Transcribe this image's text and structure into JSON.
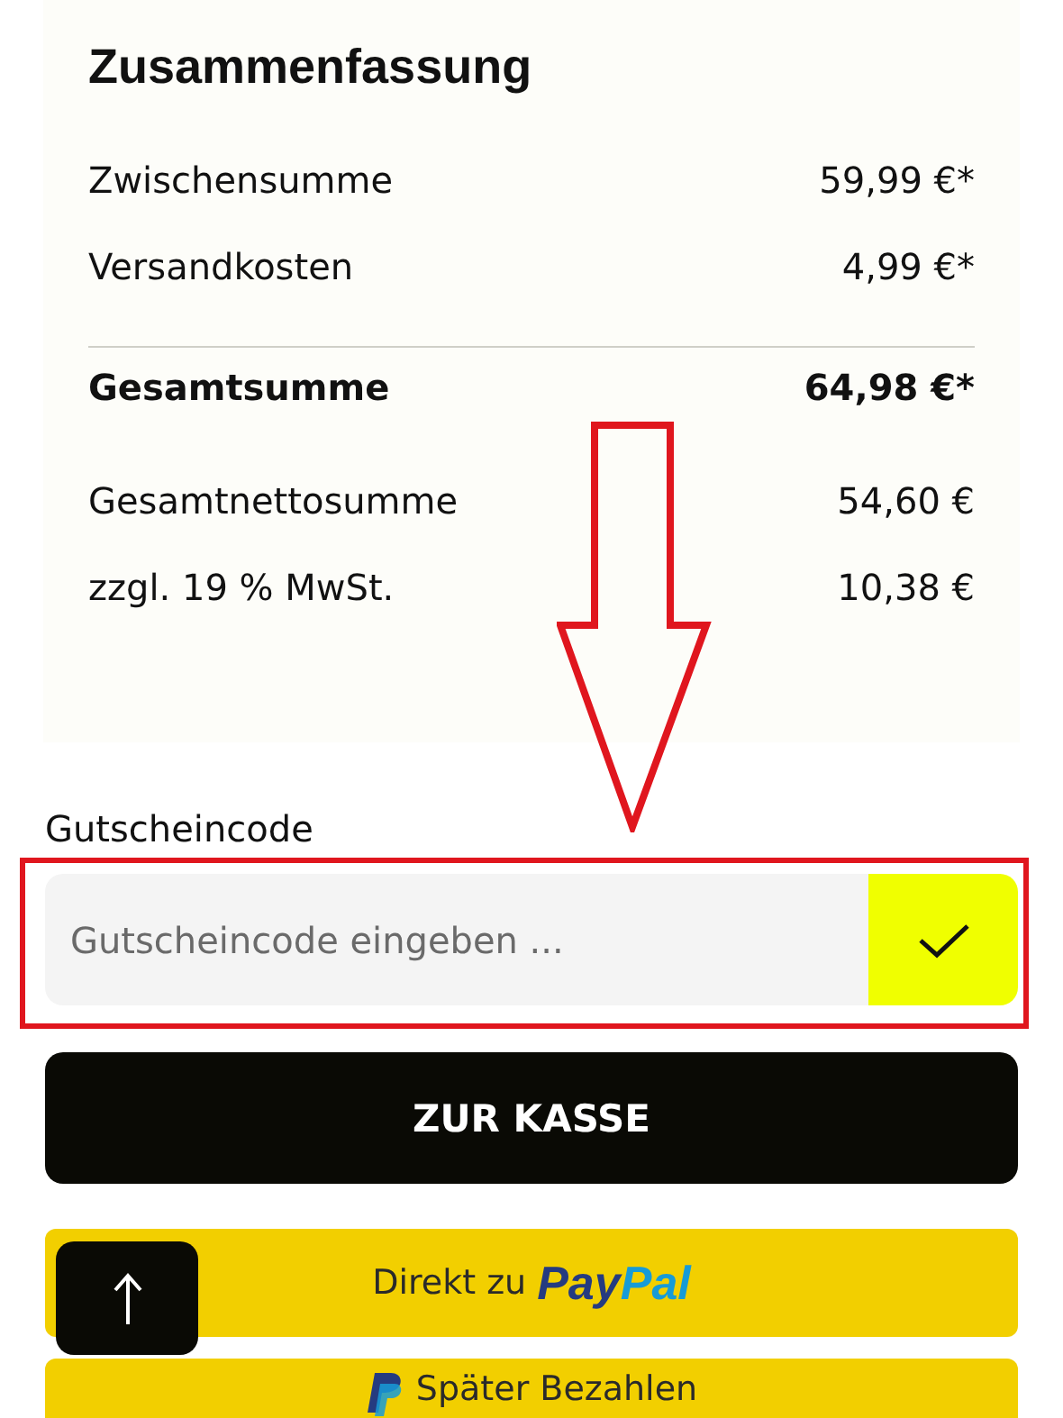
{
  "summary": {
    "title": "Zusammenfassung",
    "rows": [
      {
        "label": "Zwischensumme",
        "value": "59,99 €*",
        "kind": "normal"
      },
      {
        "label": "Versandkosten",
        "value": "4,99 €*",
        "kind": "normal"
      },
      {
        "kind": "divider"
      },
      {
        "label": "Gesamtsumme",
        "value": "64,98 €*",
        "kind": "total"
      },
      {
        "label": "Gesamtnettosumme",
        "value": "54,60 €",
        "kind": "net"
      },
      {
        "label": "zzgl. 19 % MwSt.",
        "value": "10,38 €",
        "kind": "normal"
      }
    ]
  },
  "coupon": {
    "label": "Gutscheincode",
    "placeholder": "Gutscheincode eingeben ..."
  },
  "checkout_button": "ZUR KASSE",
  "paypal_button": {
    "text": "Direkt zu",
    "logo_parts": [
      "Pay",
      "Pal"
    ]
  },
  "paylater_button": "Später Bezahlen"
}
